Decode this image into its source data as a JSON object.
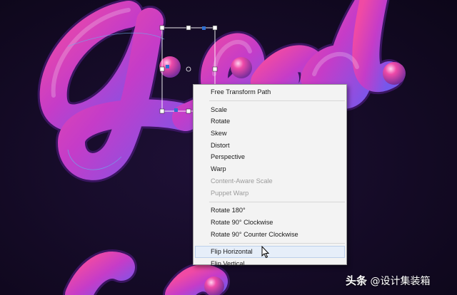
{
  "context_menu": {
    "items": [
      {
        "label": "Free Transform Path",
        "enabled": true
      },
      {
        "separator": true
      },
      {
        "label": "Scale",
        "enabled": true
      },
      {
        "label": "Rotate",
        "enabled": true
      },
      {
        "label": "Skew",
        "enabled": true
      },
      {
        "label": "Distort",
        "enabled": true
      },
      {
        "label": "Perspective",
        "enabled": true
      },
      {
        "label": "Warp",
        "enabled": true
      },
      {
        "label": "Content-Aware Scale",
        "enabled": false
      },
      {
        "label": "Puppet Warp",
        "enabled": false
      },
      {
        "separator": true
      },
      {
        "label": "Rotate 180°",
        "enabled": true
      },
      {
        "label": "Rotate 90° Clockwise",
        "enabled": true
      },
      {
        "label": "Rotate 90° Counter Clockwise",
        "enabled": true
      },
      {
        "separator": true
      },
      {
        "label": "Flip Horizontal",
        "enabled": true,
        "hovered": true
      },
      {
        "label": "Flip Vertical",
        "enabled": true
      }
    ]
  },
  "watermark": {
    "brand": "头条",
    "text": " @设计集装箱"
  },
  "colors": {
    "background": "#140a26",
    "tube_pink": "#e23a9a",
    "tube_purple": "#7b55e8",
    "menu_bg": "#f3f3f3",
    "hover_bg": "#e6eef9"
  },
  "icons": {
    "cursor": "arrow-pointer-icon",
    "anchor": "anchor-point-icon"
  }
}
